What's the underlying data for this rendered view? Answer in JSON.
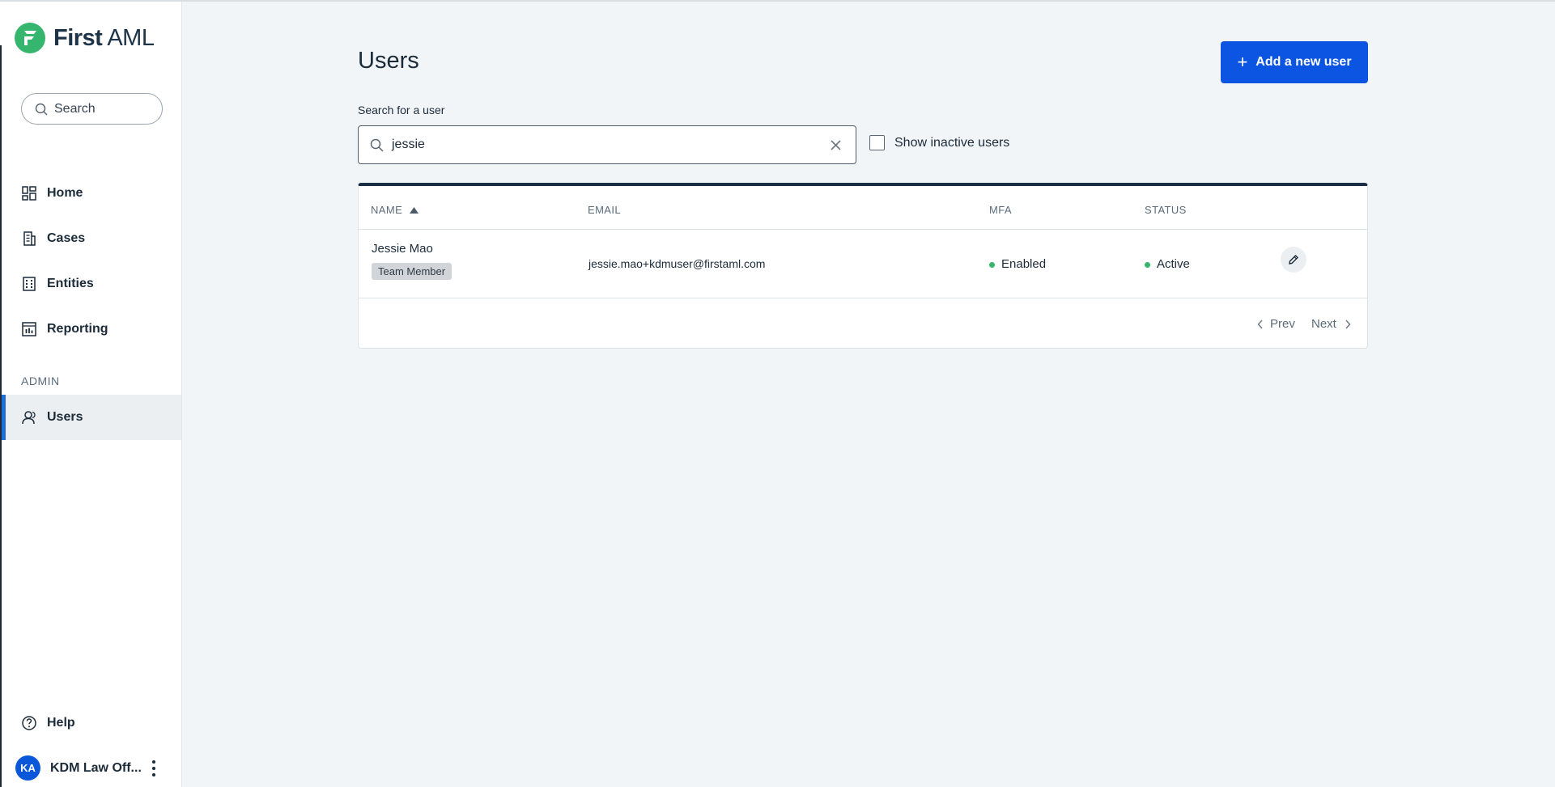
{
  "brand": {
    "name_bold": "First",
    "name_light": "AML",
    "color": "#35b56d"
  },
  "sidebar": {
    "search_label": "Search",
    "nav": [
      {
        "label": "Home",
        "icon": "home-grid-icon"
      },
      {
        "label": "Cases",
        "icon": "cases-icon"
      },
      {
        "label": "Entities",
        "icon": "entities-icon"
      },
      {
        "label": "Reporting",
        "icon": "reporting-icon"
      }
    ],
    "admin_section_label": "ADMIN",
    "admin_nav": [
      {
        "label": "Users",
        "icon": "users-icon",
        "active": true
      }
    ],
    "help_label": "Help",
    "account": {
      "initials": "KA",
      "name": "KDM Law Off..."
    }
  },
  "main": {
    "title": "Users",
    "add_button_label": "Add a new user",
    "search": {
      "label": "Search for a user",
      "value": "jessie"
    },
    "show_inactive_label": "Show inactive users",
    "show_inactive_checked": false,
    "table": {
      "columns": [
        "NAME",
        "EMAIL",
        "MFA",
        "STATUS"
      ],
      "sort": {
        "column": "NAME",
        "direction": "asc"
      },
      "rows": [
        {
          "name": "Jessie Mao",
          "role": "Team Member",
          "email": "jessie.mao+kdmuser@firstaml.com",
          "mfa": "Enabled",
          "status": "Active"
        }
      ]
    },
    "pagination": {
      "prev_label": "Prev",
      "next_label": "Next"
    }
  },
  "colors": {
    "accent": "#0c55e2",
    "active_indicator": "#1f6fd8",
    "status_ok": "#35b56d",
    "table_top_border": "#1a2f45"
  }
}
